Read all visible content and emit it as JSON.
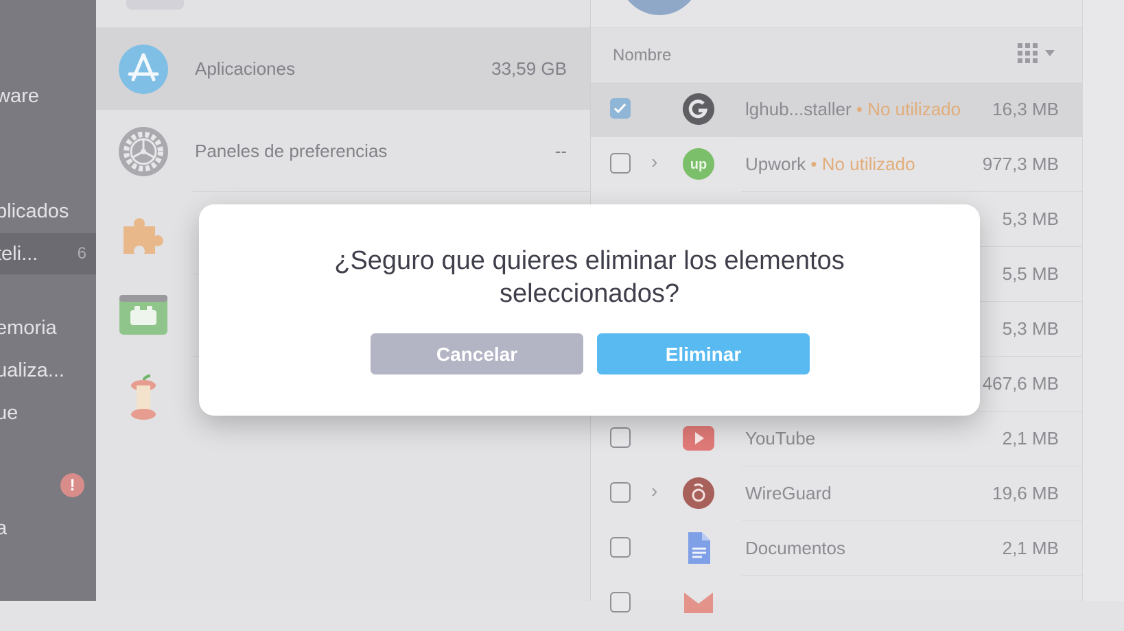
{
  "sidebar": {
    "items": [
      {
        "label": "ware"
      },
      {
        "label": "plicados"
      },
      {
        "label": "teli...",
        "count": "6"
      },
      {
        "label": "emoria"
      },
      {
        "label": "ualiza..."
      },
      {
        "label": "ue"
      },
      {
        "label": "a"
      }
    ],
    "alert_glyph": "!"
  },
  "categories": {
    "items": [
      {
        "label": "Aplicaciones",
        "size": "33,59 GB",
        "icon": "app-store-icon"
      },
      {
        "label": "Paneles de preferencias",
        "size": "--",
        "icon": "gear-icon"
      },
      {
        "label": "",
        "size": "",
        "icon": "puzzle-icon"
      },
      {
        "label": "",
        "size": "",
        "icon": "launcher-icon"
      },
      {
        "label": "",
        "size": "",
        "icon": "apple-core-icon"
      }
    ]
  },
  "list": {
    "header_name": "Nombre",
    "rows": [
      {
        "name": "lghub...staller",
        "tag": "• No utilizado",
        "size": "16,3 MB",
        "checked": true
      },
      {
        "name": "Upwork",
        "tag": "• No utilizado",
        "size": "977,3 MB",
        "checked": false
      },
      {
        "name": "",
        "tag": "",
        "size": "5,3 MB",
        "checked": false
      },
      {
        "name": "",
        "tag": "",
        "size": "5,5 MB",
        "checked": false
      },
      {
        "name": "",
        "tag": "",
        "size": "5,3 MB",
        "checked": false
      },
      {
        "name": "",
        "tag": "",
        "size": "467,6 MB",
        "checked": false
      },
      {
        "name": "YouTube",
        "tag": "",
        "size": "2,1 MB",
        "checked": false
      },
      {
        "name": "WireGuard",
        "tag": "",
        "size": "19,6 MB",
        "checked": false
      },
      {
        "name": "Documentos",
        "tag": "",
        "size": "2,1 MB",
        "checked": false
      }
    ]
  },
  "dialog": {
    "message_line1": "¿Seguro que quieres eliminar los elementos",
    "message_line2": "seleccionados?",
    "cancel_label": "Cancelar",
    "delete_label": "Eliminar"
  },
  "colors": {
    "accent": "#59baf2",
    "cancel": "#b3b4c4",
    "unused_tag": "#e2ad7a"
  }
}
